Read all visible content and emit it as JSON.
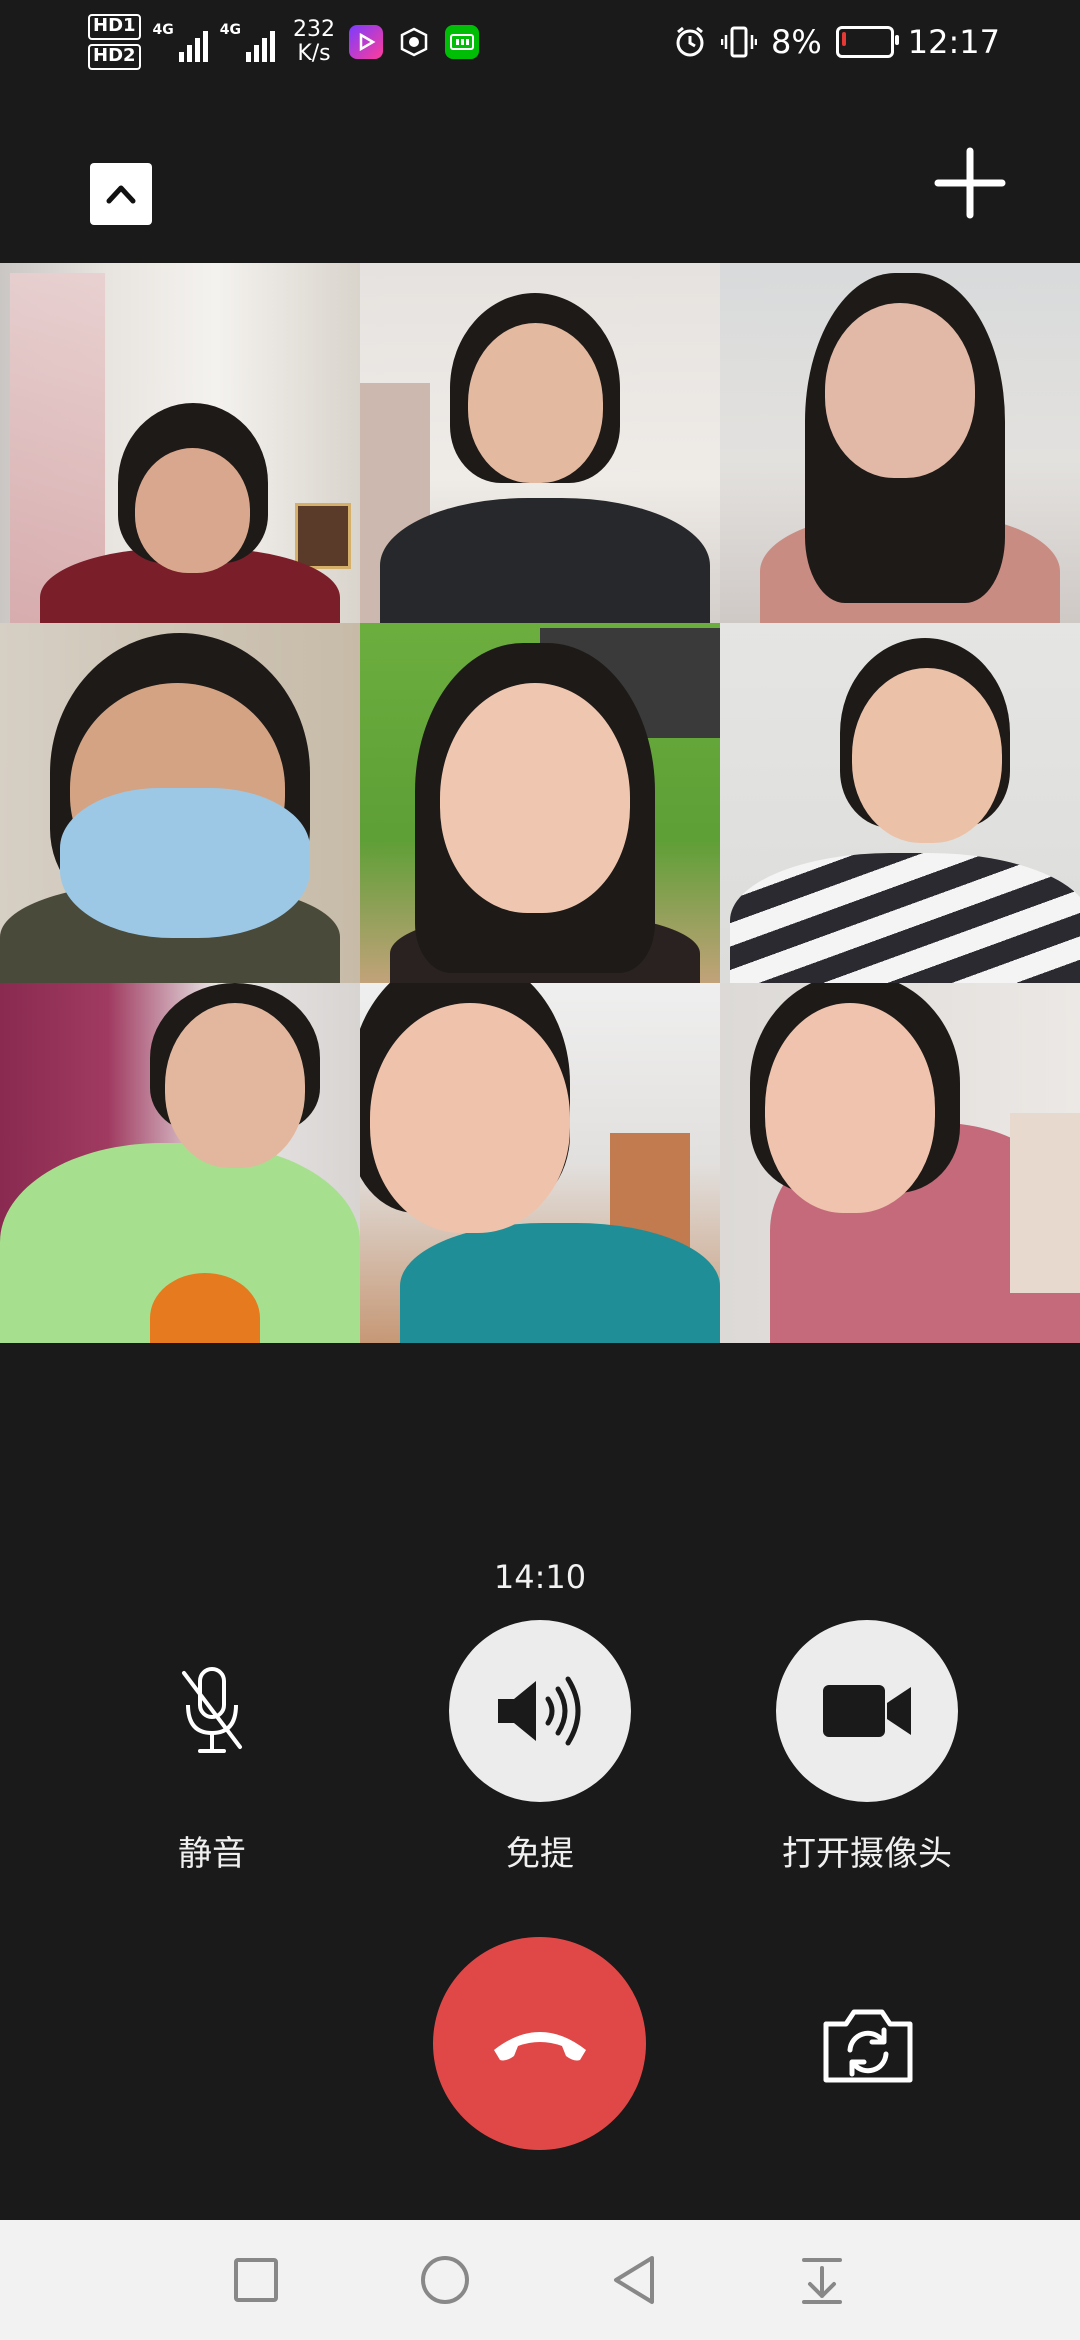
{
  "status_bar": {
    "hd1": "HD1",
    "hd2": "HD2",
    "net1": "4G",
    "net2": "4G",
    "speed_value": "232",
    "speed_unit": "K/s",
    "battery_percent": "8%",
    "time": "12:17",
    "battery_level": 0.08,
    "battery_color": "#e53935"
  },
  "top_bar": {
    "collapse_icon": "chevron-up-icon",
    "add_icon": "plus-icon"
  },
  "call": {
    "duration": "14:10",
    "participant_count": 9
  },
  "controls": {
    "mute_label": "静音",
    "speaker_label": "免提",
    "camera_label": "打开摄像头",
    "hangup_color": "#e04848"
  },
  "nav_bar": {
    "icons": [
      "square-icon",
      "circle-icon",
      "triangle-back-icon",
      "download-icon"
    ]
  }
}
